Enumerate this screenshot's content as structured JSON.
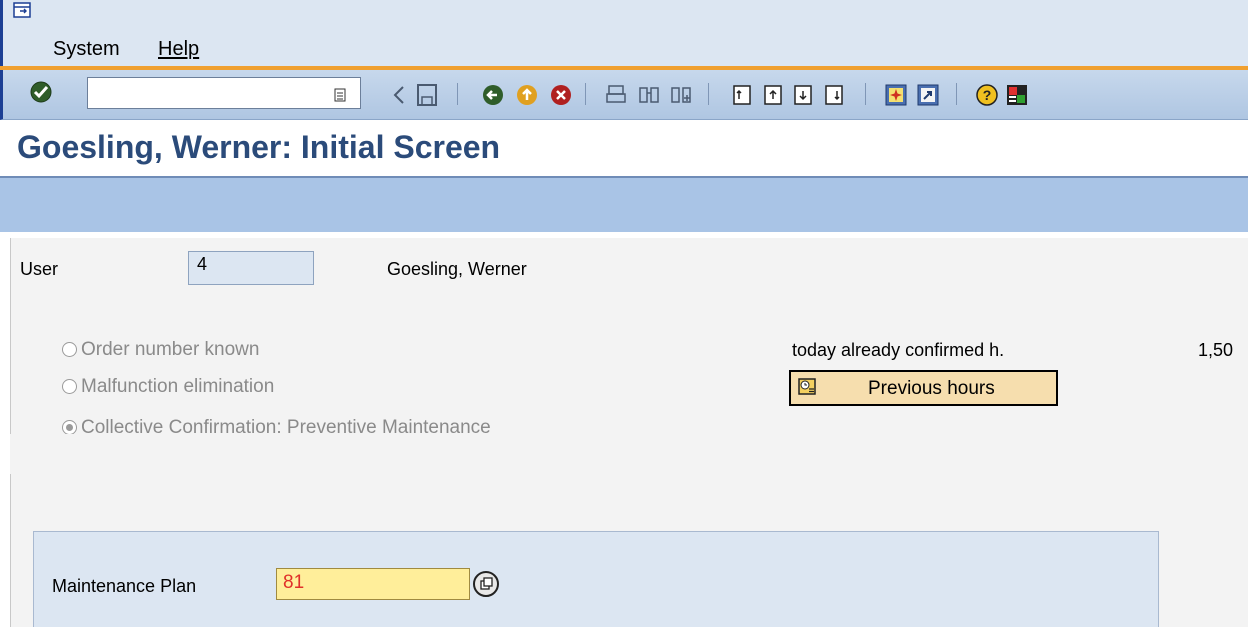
{
  "menu": {
    "items": [
      "System",
      "Help"
    ]
  },
  "toolbar": {
    "command_value": ""
  },
  "title": "Goesling, Werner: Initial Screen",
  "user": {
    "label": "User",
    "value": "4",
    "name": "Goesling, Werner"
  },
  "radios": [
    {
      "label": "Order number known",
      "selected": false
    },
    {
      "label": "Malfunction elimination",
      "selected": false
    },
    {
      "label": "Collective Confirmation: Preventive Maintenance",
      "selected": true
    }
  ],
  "confirmed": {
    "label": "today already confirmed h.",
    "value": "1,50"
  },
  "previous_hours_button": "Previous hours",
  "plan": {
    "label": "Maintenance Plan",
    "value": "81"
  },
  "colors": {
    "menubar": "#dce6f2",
    "toolbar": "#afc6e2",
    "title": "#2b4b7a",
    "accent": "#f0a030"
  },
  "icons": [
    "enter-icon",
    "save-icon",
    "back-icon",
    "exit-icon",
    "cancel-icon",
    "print-icon",
    "find-icon",
    "find-next-icon",
    "first-page-icon",
    "previous-page-icon",
    "next-page-icon",
    "last-page-icon",
    "new-session-icon",
    "shortcut-icon",
    "help-icon",
    "layout-icon"
  ]
}
